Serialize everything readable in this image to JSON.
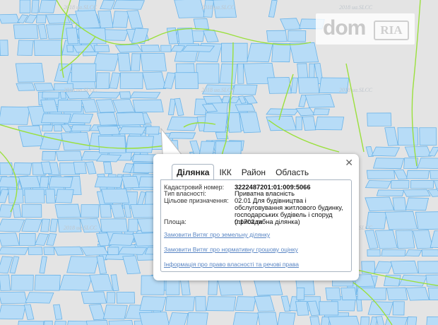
{
  "watermark": "2018 ua.SLCC",
  "logo": {
    "part1": "dom",
    "part2": "RIA"
  },
  "popup": {
    "close_icon": "close-icon",
    "tabs": [
      {
        "label": "Ділянка",
        "active": true
      },
      {
        "label": "ІКК",
        "active": false
      },
      {
        "label": "Район",
        "active": false
      },
      {
        "label": "Область",
        "active": false
      }
    ],
    "fields": {
      "cadastral_label": "Кадастровий номер:",
      "cadastral_value": "3222487201:01:009:5066",
      "ownership_label": "Тип власності:",
      "ownership_value": "Приватна власність",
      "purpose_label": "Цільове призначення:",
      "purpose_value": "02.01 Для будівництва і обслуговування житлового будинку, господарських будівель і споруд (присадибна ділянка)",
      "area_label": "Площа:",
      "area_value": "0.1702 га"
    },
    "links": [
      "Замовити Витяг про земельну ділянку",
      "Замовити Витяг про нормативну грошову оцінку",
      "Інформація про право власності та речові права"
    ]
  }
}
